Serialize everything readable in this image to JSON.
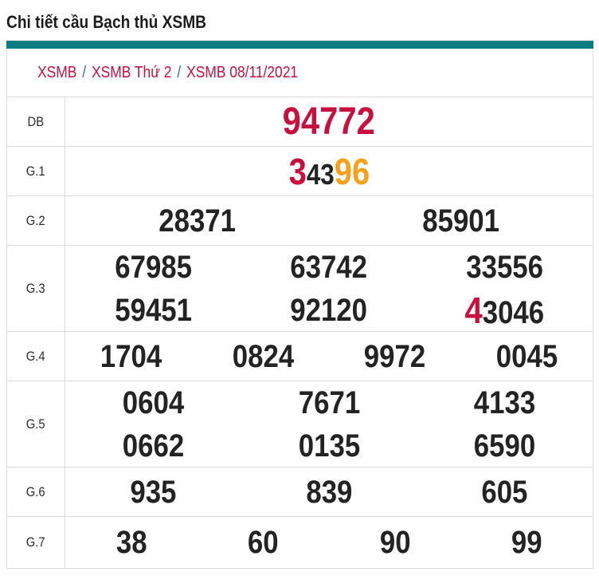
{
  "page_title": "Chi tiết cầu Bạch thủ XSMB",
  "breadcrumb": {
    "separator": "/",
    "items": [
      "XSMB",
      "XSMB Thứ 2",
      "XSMB 08/11/2021"
    ]
  },
  "colors": {
    "accent_teal": "#0A7C82",
    "crimson": "#C8103E",
    "orange": "#F7A11C",
    "number_dark": "#232323",
    "breadcrumb_slash_blue": "#3B6EA5",
    "grid_border": "#DBDBDB"
  },
  "results_table": {
    "rows": [
      {
        "label": "DB",
        "lines": [
          [
            [
              {
                "t": "94772",
                "c": "crimson",
                "s": "xl"
              }
            ]
          ]
        ]
      },
      {
        "label": "G.1",
        "lines": [
          [
            [
              {
                "t": "3",
                "c": "crimson",
                "s": "lg"
              },
              {
                "t": "43",
                "c": "dark",
                "s": "md"
              },
              {
                "t": "96",
                "c": "orange",
                "s": "lg"
              }
            ]
          ]
        ]
      },
      {
        "label": "G.2",
        "lines": [
          [
            [
              {
                "t": "28371",
                "c": "dark",
                "s": "num"
              }
            ],
            [
              {
                "t": "85901",
                "c": "dark",
                "s": "num"
              }
            ]
          ]
        ]
      },
      {
        "label": "G.3",
        "lines": [
          [
            [
              {
                "t": "67985",
                "c": "dark",
                "s": "num"
              }
            ],
            [
              {
                "t": "63742",
                "c": "dark",
                "s": "num"
              }
            ],
            [
              {
                "t": "33556",
                "c": "dark",
                "s": "num"
              }
            ]
          ],
          [
            [
              {
                "t": "59451",
                "c": "dark",
                "s": "num"
              }
            ],
            [
              {
                "t": "92120",
                "c": "dark",
                "s": "num"
              }
            ],
            [
              {
                "t": "4",
                "c": "crimson",
                "s": "lg"
              },
              {
                "t": "3046",
                "c": "dark",
                "s": "num"
              }
            ]
          ]
        ]
      },
      {
        "label": "G.4",
        "lines": [
          [
            [
              {
                "t": "1704",
                "c": "dark",
                "s": "num"
              }
            ],
            [
              {
                "t": "0824",
                "c": "dark",
                "s": "num"
              }
            ],
            [
              {
                "t": "9972",
                "c": "dark",
                "s": "num"
              }
            ],
            [
              {
                "t": "0045",
                "c": "dark",
                "s": "num"
              }
            ]
          ]
        ]
      },
      {
        "label": "G.5",
        "lines": [
          [
            [
              {
                "t": "0604",
                "c": "dark",
                "s": "num"
              }
            ],
            [
              {
                "t": "7671",
                "c": "dark",
                "s": "num"
              }
            ],
            [
              {
                "t": "4133",
                "c": "dark",
                "s": "num"
              }
            ]
          ],
          [
            [
              {
                "t": "0662",
                "c": "dark",
                "s": "num"
              }
            ],
            [
              {
                "t": "0135",
                "c": "dark",
                "s": "num"
              }
            ],
            [
              {
                "t": "6590",
                "c": "dark",
                "s": "num"
              }
            ]
          ]
        ]
      },
      {
        "label": "G.6",
        "lines": [
          [
            [
              {
                "t": "935",
                "c": "dark",
                "s": "num"
              }
            ],
            [
              {
                "t": "839",
                "c": "dark",
                "s": "num"
              }
            ],
            [
              {
                "t": "605",
                "c": "dark",
                "s": "num"
              }
            ]
          ]
        ]
      },
      {
        "label": "G.7",
        "lines": [
          [
            [
              {
                "t": "38",
                "c": "dark",
                "s": "num"
              }
            ],
            [
              {
                "t": "60",
                "c": "dark",
                "s": "num"
              }
            ],
            [
              {
                "t": "90",
                "c": "dark",
                "s": "num"
              }
            ],
            [
              {
                "t": "99",
                "c": "dark",
                "s": "num"
              }
            ]
          ]
        ]
      }
    ]
  }
}
